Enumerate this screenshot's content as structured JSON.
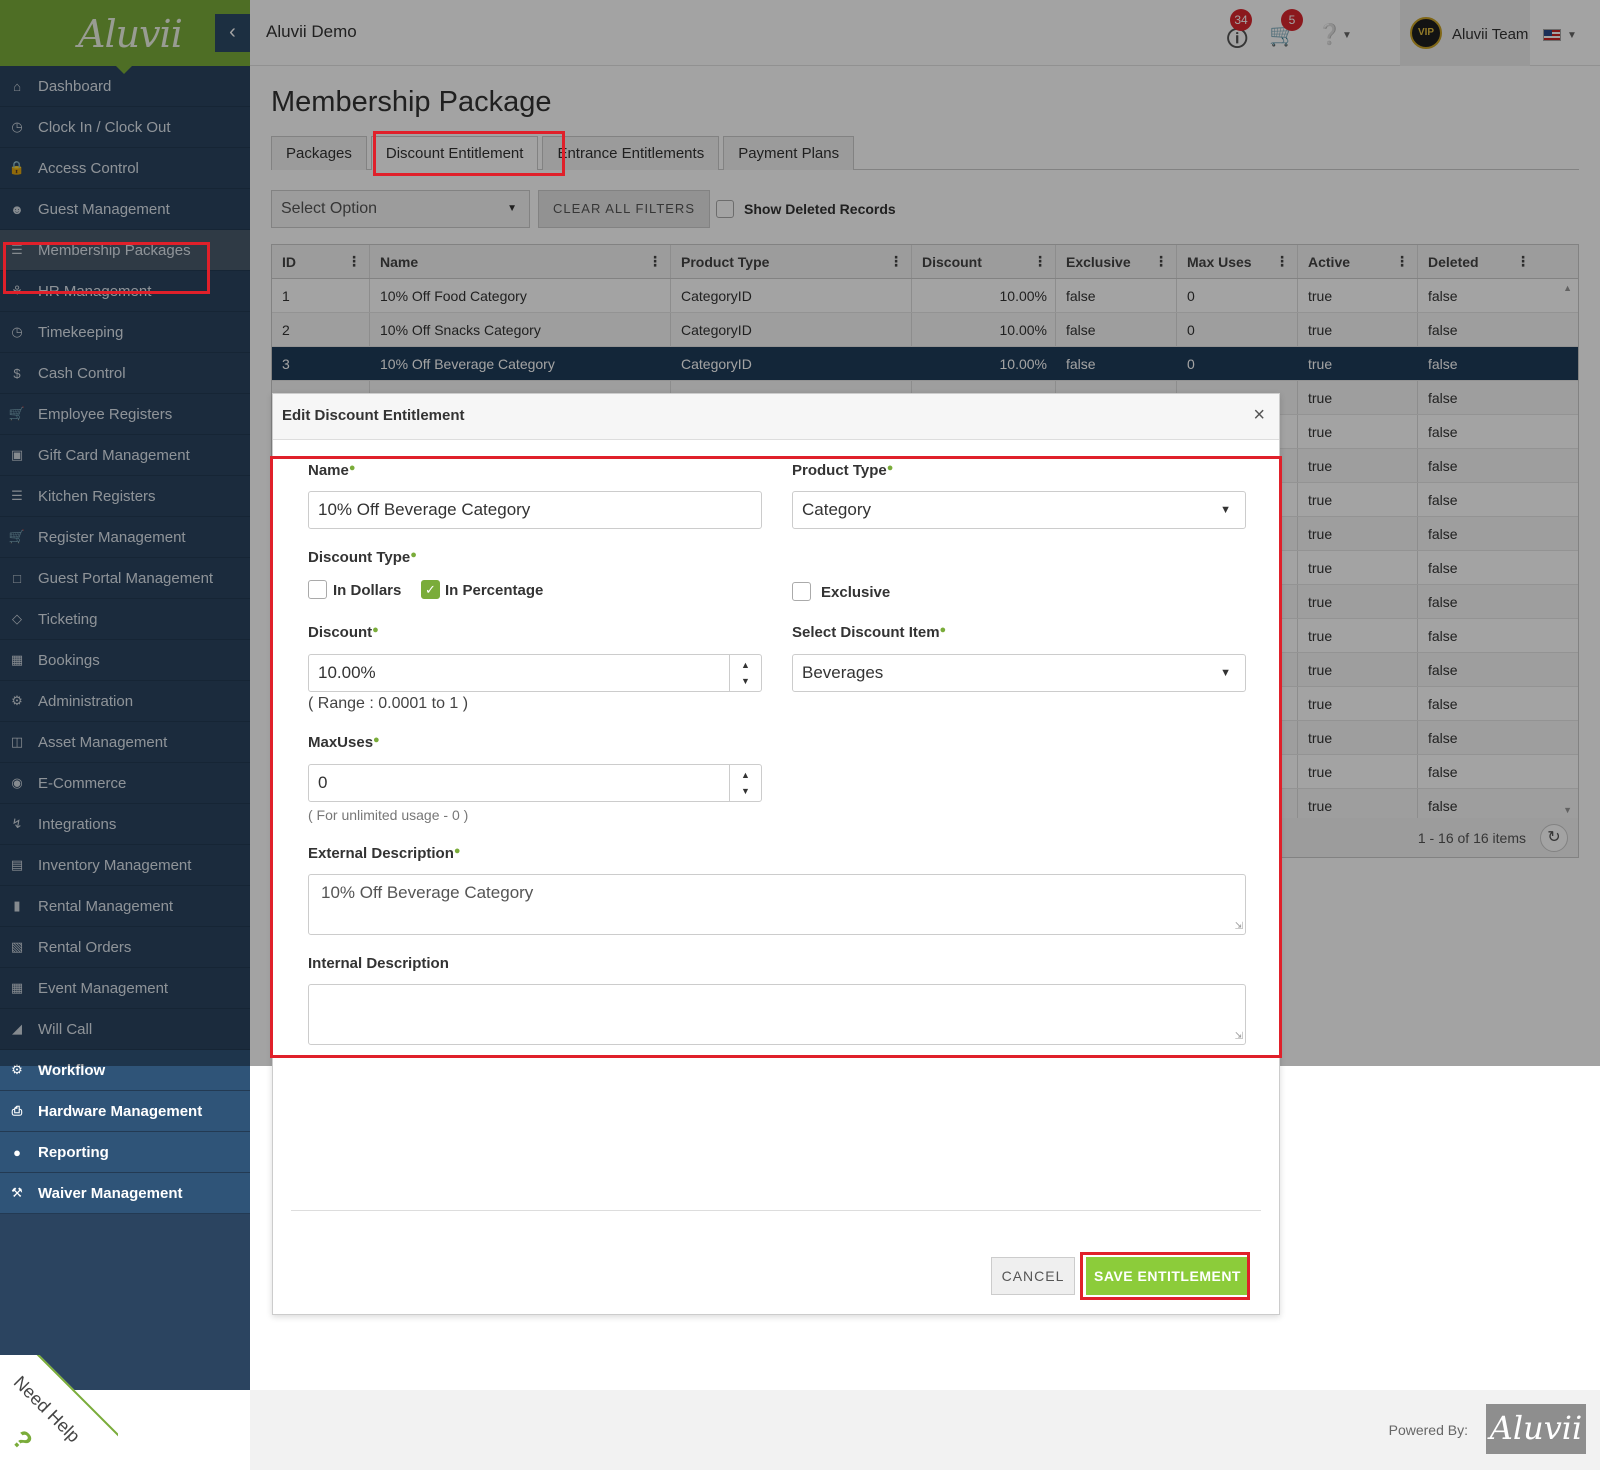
{
  "app": {
    "logo": "Aluvii",
    "org_name": "Aluvii Demo",
    "user_name": "Aluvii Team",
    "avatar_text": "VIP"
  },
  "topbar": {
    "notifications_count": "34",
    "cart_count": "5",
    "help_icon": "question-circle-icon"
  },
  "sidebar": {
    "items": [
      {
        "label": "Dashboard",
        "icon": "home-icon"
      },
      {
        "label": "Clock In / Clock Out",
        "icon": "clock-icon"
      },
      {
        "label": "Access Control",
        "icon": "lock-icon"
      },
      {
        "label": "Guest Management",
        "icon": "users-icon"
      },
      {
        "label": "Membership Packages",
        "icon": "list-icon"
      },
      {
        "label": "HR Management",
        "icon": "glass-icon"
      },
      {
        "label": "Timekeeping",
        "icon": "clock-icon"
      },
      {
        "label": "Cash Control",
        "icon": "dollar-icon"
      },
      {
        "label": "Employee Registers",
        "icon": "cart-icon"
      },
      {
        "label": "Gift Card Management",
        "icon": "gift-icon"
      },
      {
        "label": "Kitchen Registers",
        "icon": "list-icon"
      },
      {
        "label": "Register Management",
        "icon": "cart-icon"
      },
      {
        "label": "Guest Portal Management",
        "icon": "laptop-icon"
      },
      {
        "label": "Ticketing",
        "icon": "ticket-icon"
      },
      {
        "label": "Bookings",
        "icon": "calendar-icon"
      },
      {
        "label": "Administration",
        "icon": "gears-icon"
      },
      {
        "label": "Asset Management",
        "icon": "cubes-icon"
      },
      {
        "label": "E-Commerce",
        "icon": "globe-icon"
      },
      {
        "label": "Integrations",
        "icon": "bolt-icon"
      },
      {
        "label": "Inventory Management",
        "icon": "archive-icon"
      },
      {
        "label": "Rental Management",
        "icon": "clipboard-icon"
      },
      {
        "label": "Rental Orders",
        "icon": "book-icon"
      },
      {
        "label": "Event Management",
        "icon": "calendar-icon"
      },
      {
        "label": "Will Call",
        "icon": "megaphone-icon"
      }
    ],
    "lower_items": [
      {
        "label": "Workflow",
        "icon": "gear-icon"
      },
      {
        "label": "Hardware Management",
        "icon": "printer-icon"
      },
      {
        "label": "Reporting",
        "icon": "lightbulb-icon"
      },
      {
        "label": "Waiver Management",
        "icon": "gavel-icon"
      }
    ],
    "need_help": "Need Help"
  },
  "page": {
    "title": "Membership Package",
    "tabs": [
      "Packages",
      "Discount Entitlement",
      "Entrance Entitlements",
      "Payment Plans"
    ],
    "active_tab": "Discount Entitlement",
    "filter_select": "Select Option",
    "clear_filters": "CLEAR ALL FILTERS",
    "show_deleted": "Show Deleted Records"
  },
  "grid": {
    "columns": [
      "ID",
      "Name",
      "Product Type",
      "Discount",
      "Exclusive",
      "Max Uses",
      "Active",
      "Deleted"
    ],
    "rows": [
      [
        "1",
        "10% Off Food Category",
        "CategoryID",
        "10.00%",
        "false",
        "0",
        "true",
        "false"
      ],
      [
        "2",
        "10% Off Snacks Category",
        "CategoryID",
        "10.00%",
        "false",
        "0",
        "true",
        "false"
      ],
      [
        "3",
        "10% Off Beverage Category",
        "CategoryID",
        "10.00%",
        "false",
        "0",
        "true",
        "false"
      ],
      [
        "",
        "",
        "",
        "",
        "",
        "",
        "true",
        "false"
      ],
      [
        "",
        "",
        "",
        "",
        "",
        "",
        "true",
        "false"
      ],
      [
        "",
        "",
        "",
        "",
        "",
        "",
        "true",
        "false"
      ],
      [
        "",
        "",
        "",
        "",
        "",
        "",
        "true",
        "false"
      ],
      [
        "",
        "",
        "",
        "",
        "",
        "",
        "true",
        "false"
      ],
      [
        "",
        "",
        "",
        "",
        "",
        "",
        "true",
        "false"
      ],
      [
        "",
        "",
        "",
        "",
        "",
        "",
        "true",
        "false"
      ],
      [
        "",
        "",
        "",
        "",
        "",
        "",
        "true",
        "false"
      ],
      [
        "",
        "",
        "",
        "",
        "",
        "",
        "true",
        "false"
      ],
      [
        "",
        "",
        "",
        "",
        "",
        "",
        "true",
        "false"
      ],
      [
        "",
        "",
        "",
        "",
        "",
        "",
        "true",
        "false"
      ],
      [
        "",
        "",
        "",
        "",
        "",
        "",
        "true",
        "false"
      ],
      [
        "",
        "",
        "",
        "",
        "",
        "",
        "true",
        "false"
      ]
    ],
    "pager": "1 - 16 of 16 items"
  },
  "modal": {
    "title": "Edit Discount Entitlement",
    "name_label": "Name",
    "name_value": "10% Off Beverage Category",
    "product_type_label": "Product Type",
    "product_type_value": "Category",
    "discount_type_label": "Discount Type",
    "in_dollars": "In Dollars",
    "in_percentage": "In Percentage",
    "exclusive": "Exclusive",
    "discount_label": "Discount",
    "discount_value": "10.00%",
    "discount_range": "( Range : 0.0001 to 1 )",
    "discount_item_label": "Select Discount Item",
    "discount_item_value": "Beverages",
    "maxuses_label": "MaxUses",
    "maxuses_value": "0",
    "maxuses_hint": "( For unlimited usage - 0 )",
    "ext_desc_label": "External Description",
    "ext_desc_value": "10% Off Beverage Category",
    "int_desc_label": "Internal Description",
    "int_desc_value": "",
    "cancel": "CANCEL",
    "save": "SAVE ENTITLEMENT"
  },
  "footer": {
    "powered_by": "Powered By:",
    "logo": "Aluvii"
  },
  "colors": {
    "brand_green": "#7aac3a",
    "sidebar": "#2b4460",
    "highlight": "#e0202a",
    "save": "#8ccc3a"
  }
}
